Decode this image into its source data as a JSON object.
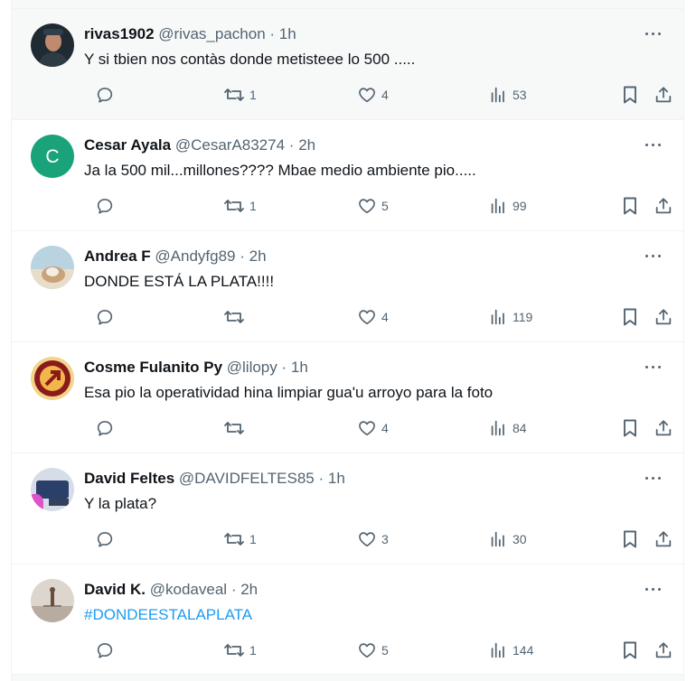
{
  "replies": [
    {
      "name": "rivas1902",
      "handle": "@rivas_pachon",
      "dot": "·",
      "time": "1h",
      "text": "Y si tbien nos contàs donde metisteee lo 500 .....",
      "replies": "",
      "retweets": "1",
      "likes": "4",
      "views": "53",
      "avatar_letter": "",
      "avatar_color": "#1f2a33",
      "hover": true,
      "link": false
    },
    {
      "name": "Cesar Ayala",
      "handle": "@CesarA83274",
      "dot": "·",
      "time": "2h",
      "text": "Ja la 500 mil...millones???? Mbae medio ambiente pio.....",
      "replies": "",
      "retweets": "1",
      "likes": "5",
      "views": "99",
      "avatar_letter": "C",
      "avatar_color": "#1aa37a",
      "hover": false,
      "link": false
    },
    {
      "name": "Andrea F",
      "handle": "@Andyfg89",
      "dot": "·",
      "time": "2h",
      "text": "DONDE ESTÁ LA PLATA!!!!",
      "replies": "",
      "retweets": "",
      "likes": "4",
      "views": "119",
      "avatar_letter": "",
      "avatar_color": "#b9d4e0",
      "hover": false,
      "link": false
    },
    {
      "name": "Cosme Fulanito Py",
      "handle": "@lilopy",
      "dot": "·",
      "time": "1h",
      "text": "Esa pio la operatividad hina limpiar gua'u arroyo para la foto",
      "replies": "",
      "retweets": "",
      "likes": "4",
      "views": "84",
      "avatar_letter": "",
      "avatar_color": "#8b1a1a",
      "hover": false,
      "link": false
    },
    {
      "name": "David Feltes",
      "handle": "@DAVIDFELTES85",
      "dot": "·",
      "time": "1h",
      "text": "Y la plata?",
      "replies": "",
      "retweets": "1",
      "likes": "3",
      "views": "30",
      "avatar_letter": "",
      "avatar_color": "#2b3f6b",
      "hover": false,
      "link": false
    },
    {
      "name": "David K.",
      "handle": "@kodaveal",
      "dot": "·",
      "time": "2h",
      "text": "#DONDEESTALAPLATA",
      "replies": "",
      "retweets": "1",
      "likes": "5",
      "views": "144",
      "avatar_letter": "",
      "avatar_color": "#c9c4bd",
      "hover": false,
      "link": true
    }
  ],
  "colors": {
    "text": "#0f1419",
    "secondary": "#536471",
    "link": "#1d9bf0",
    "border": "#eff3f4"
  },
  "icons": {
    "reply": "reply-icon",
    "retweet": "retweet-icon",
    "like": "heart-icon",
    "views": "views-icon",
    "bookmark": "bookmark-icon",
    "share": "share-icon",
    "more": "more-icon"
  }
}
